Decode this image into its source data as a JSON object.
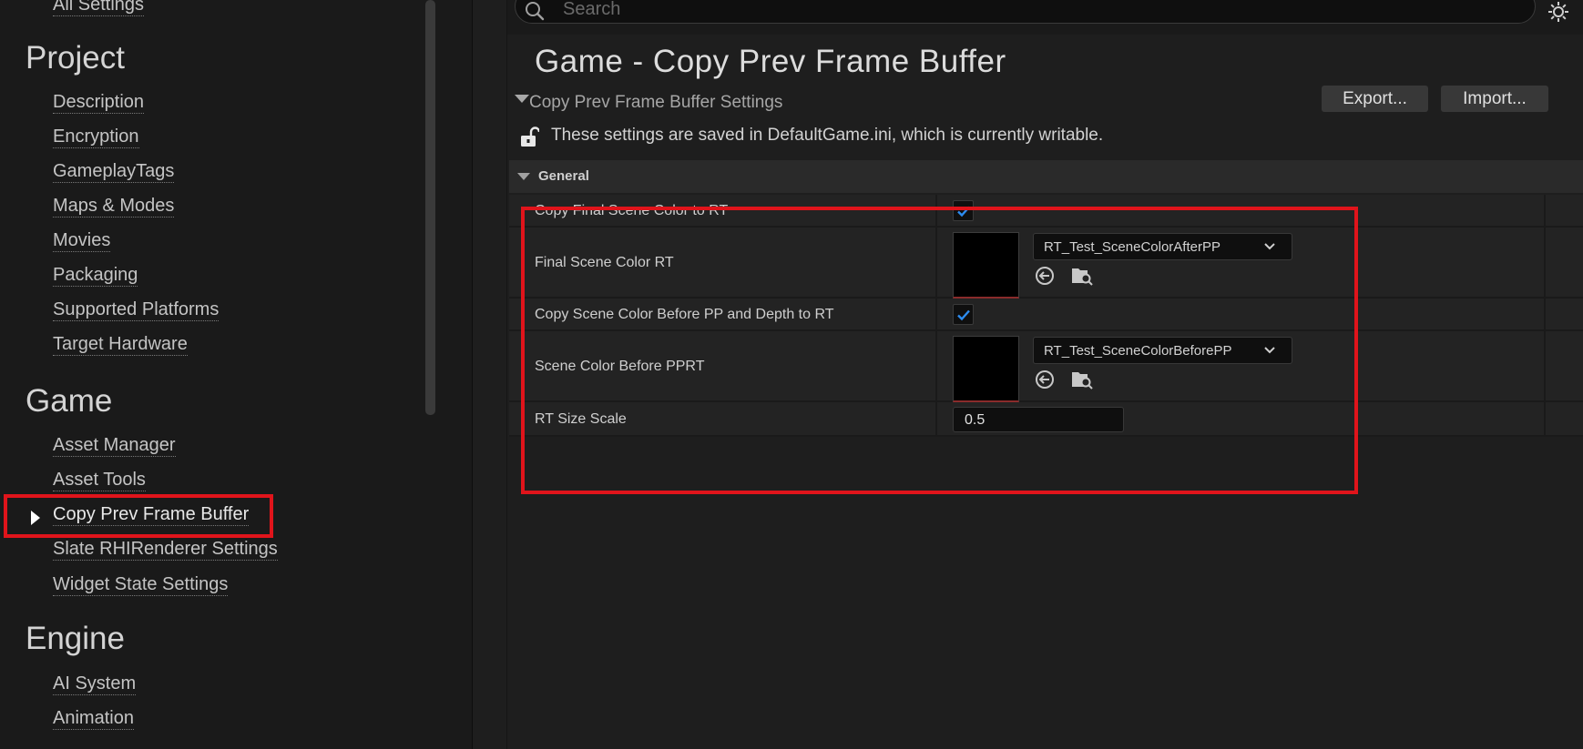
{
  "sidebar": {
    "top_item": "All Settings",
    "sections": [
      {
        "title": "Project",
        "items": [
          "Description",
          "Encryption",
          "GameplayTags",
          "Maps & Modes",
          "Movies",
          "Packaging",
          "Supported Platforms",
          "Target Hardware"
        ]
      },
      {
        "title": "Game",
        "items": [
          "Asset Manager",
          "Asset Tools",
          "Copy Prev Frame Buffer",
          "Slate RHIRenderer Settings",
          "Widget State Settings"
        ]
      },
      {
        "title": "Engine",
        "items": [
          "AI System",
          "Animation"
        ]
      }
    ],
    "active_item": "Copy Prev Frame Buffer"
  },
  "search": {
    "placeholder": "Search"
  },
  "header": {
    "title": "Game - Copy Prev Frame Buffer",
    "subtitle": "Copy Prev Frame Buffer Settings",
    "export_label": "Export...",
    "import_label": "Import...",
    "note": "These settings are saved in DefaultGame.ini, which is currently writable."
  },
  "category": {
    "label": "General"
  },
  "properties": {
    "copy_final": {
      "label": "Copy Final Scene Color to RT",
      "checked": true
    },
    "final_rt": {
      "label": "Final Scene Color RT",
      "asset": "RT_Test_SceneColorAfterPP"
    },
    "copy_before": {
      "label": "Copy Scene Color Before PP and Depth to RT",
      "checked": true
    },
    "before_rt": {
      "label": "Scene Color Before PPRT",
      "asset": "RT_Test_SceneColorBeforePP"
    },
    "rt_size": {
      "label": "RT Size Scale",
      "value": "0.5"
    }
  },
  "colors": {
    "highlight": "#e0141b",
    "checkbox_tick": "#2d8cf0",
    "background": "#1a1a1a"
  }
}
